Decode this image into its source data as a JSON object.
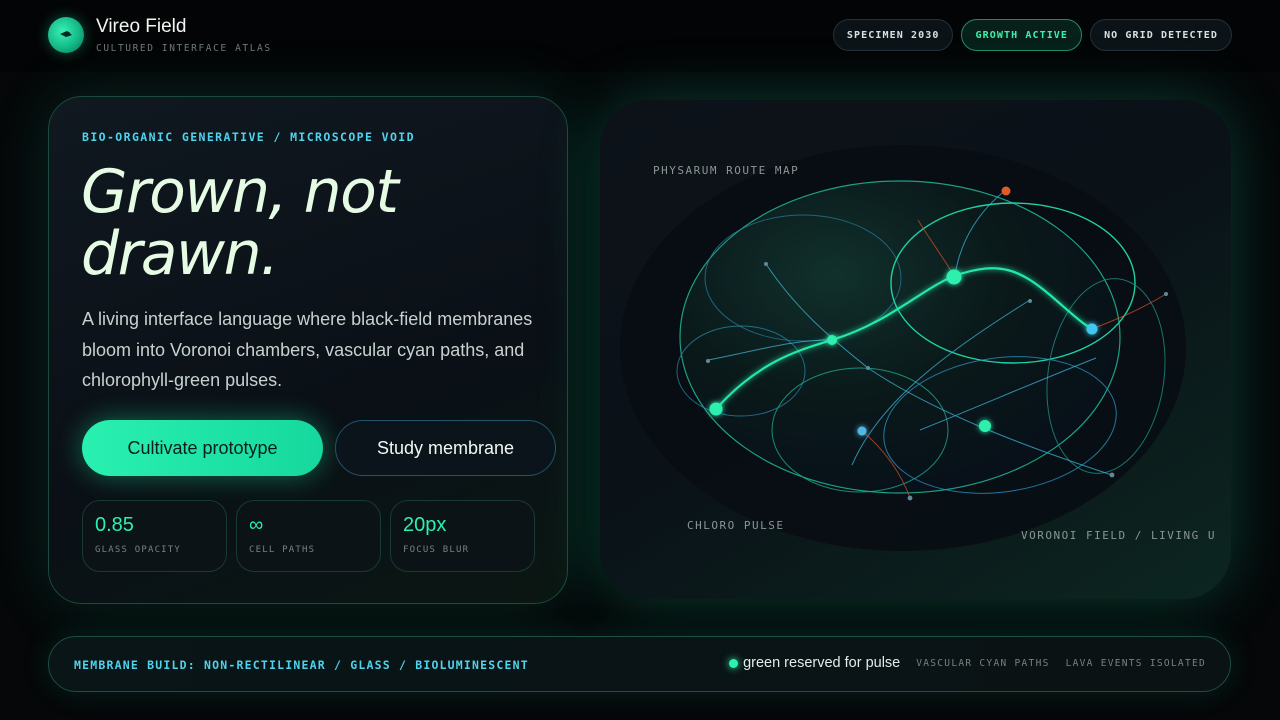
{
  "brand": {
    "name": "Vireo Field",
    "subtitle": "CULTURED INTERFACE ATLAS",
    "icon": "membrane-cell-icon"
  },
  "status_pills": [
    {
      "label": "SPECIMEN 2030",
      "active": false
    },
    {
      "label": "GROWTH ACTIVE",
      "active": true
    },
    {
      "label": "NO GRID DETECTED",
      "active": false
    }
  ],
  "hero": {
    "eyebrow": "BIO-ORGANIC GENERATIVE / MICROSCOPE VOID",
    "headline_line1": "Grown, not",
    "headline_line2": "drawn.",
    "lede": "A living interface language where black-field membranes bloom into Voronoi chambers, vascular cyan paths, and chlorophyll-green pulses.",
    "primary_button": "Cultivate prototype",
    "secondary_button": "Study membrane",
    "stats": [
      {
        "value": "0.85",
        "label": "GLASS OPACITY"
      },
      {
        "value": "∞",
        "label": "CELL PATHS"
      },
      {
        "value": "20px",
        "label": "FOCUS BLUR"
      }
    ]
  },
  "field": {
    "label_top": "PHYSARUM ROUTE MAP",
    "label_bottom_left": "CHLORO PULSE",
    "label_bottom_right": "VORONOI FIELD / LIVING UI"
  },
  "footer": {
    "build_label": "MEMBRANE BUILD: NON-RECTILINEAR / GLASS / BIOLUMINESCENT",
    "pulse_note": "green reserved for pulse",
    "tags": [
      "VASCULAR CYAN PATHS",
      "LAVA EVENTS ISOLATED"
    ]
  },
  "colors": {
    "background": "#050709",
    "chlorophyll_green": "#2ef0ae",
    "vascular_cyan": "#4fd3ec",
    "lava": "#e0502a"
  }
}
